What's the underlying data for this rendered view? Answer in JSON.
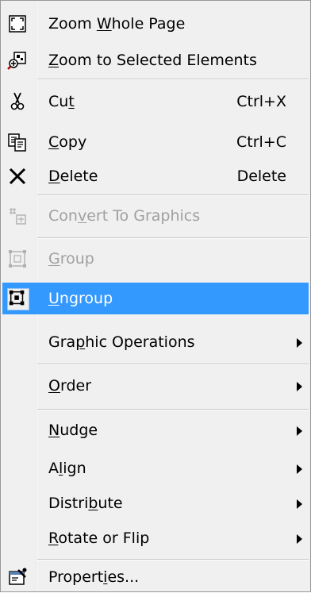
{
  "menu": {
    "items": [
      {
        "key": "zoom_whole_page",
        "label": {
          "before": "Zoom ",
          "mn": "W",
          "after": "hole Page"
        },
        "icon": "zoom-whole-page-icon",
        "disabled": false
      },
      {
        "key": "zoom_selected",
        "label": {
          "before": "",
          "mn": "Z",
          "after": "oom to Selected Elements"
        },
        "icon": "zoom-selected-icon",
        "disabled": false
      },
      {
        "key": "cut",
        "label": {
          "before": "Cu",
          "mn": "t",
          "after": ""
        },
        "shortcut": "Ctrl+X",
        "icon": "scissors-icon",
        "disabled": false
      },
      {
        "key": "copy",
        "label": {
          "before": "",
          "mn": "C",
          "after": "opy"
        },
        "shortcut": "Ctrl+C",
        "icon": "copy-icon",
        "disabled": false
      },
      {
        "key": "delete",
        "label": {
          "before": "",
          "mn": "D",
          "after": "elete"
        },
        "shortcut": "Delete",
        "icon": "delete-x-icon",
        "disabled": false
      },
      {
        "key": "convert",
        "label": {
          "before": "Con",
          "mn": "v",
          "after": "ert To Graphics"
        },
        "icon": "convert-graphics-icon",
        "disabled": true
      },
      {
        "key": "group",
        "label": {
          "before": "",
          "mn": "G",
          "after": "roup"
        },
        "icon": "group-icon",
        "disabled": true
      },
      {
        "key": "ungroup",
        "label": {
          "before": "",
          "mn": "U",
          "after": "ngroup"
        },
        "icon": "ungroup-icon",
        "disabled": false,
        "highlighted": true
      },
      {
        "key": "graphic_ops",
        "label": {
          "before": "Gra",
          "mn": "p",
          "after": "hic Operations"
        },
        "submenu": true
      },
      {
        "key": "order",
        "label": {
          "before": "",
          "mn": "O",
          "after": "rder"
        },
        "submenu": true
      },
      {
        "key": "nudge",
        "label": {
          "before": "",
          "mn": "N",
          "after": "udge"
        },
        "submenu": true
      },
      {
        "key": "align",
        "label": {
          "before": "A",
          "mn": "l",
          "after": "ign"
        },
        "submenu": true
      },
      {
        "key": "distribute",
        "label": {
          "before": "Distri",
          "mn": "b",
          "after": "ute"
        },
        "submenu": true
      },
      {
        "key": "rotate",
        "label": {
          "before": "",
          "mn": "R",
          "after": "otate or Flip"
        },
        "submenu": true
      },
      {
        "key": "properties",
        "label": {
          "before": "Propert",
          "mn": "i",
          "after": "es..."
        },
        "icon": "properties-icon",
        "disabled": false
      }
    ]
  },
  "colors": {
    "highlight": "#3399ff",
    "disabled_text": "#a0a0a0",
    "menu_background": "#f0f0f0"
  }
}
